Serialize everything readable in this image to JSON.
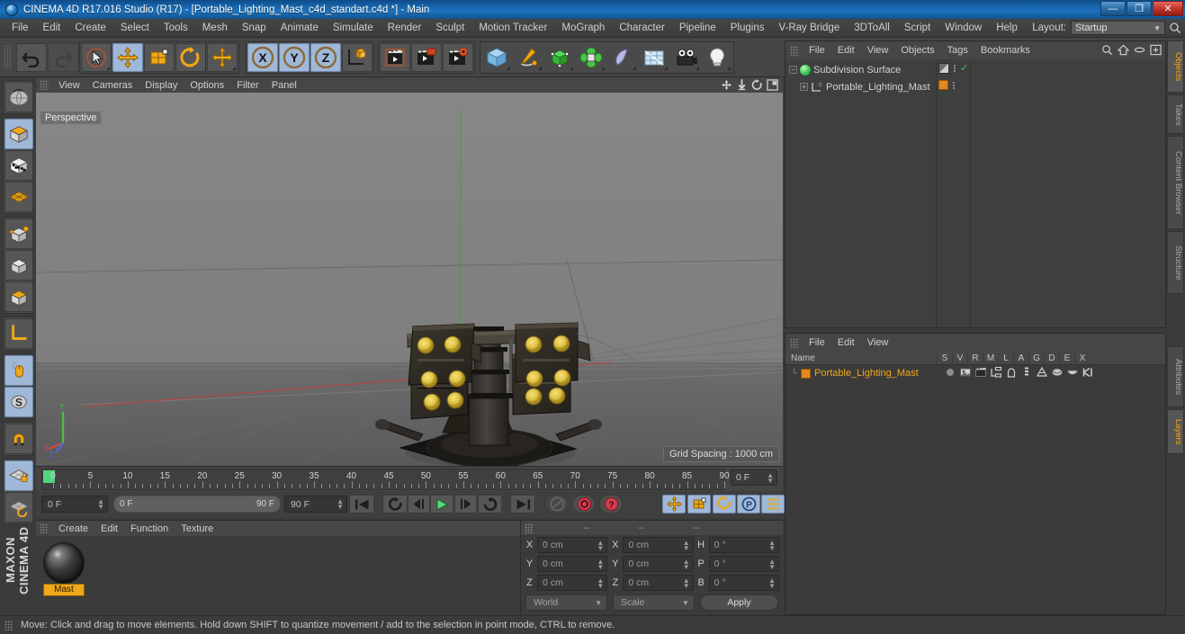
{
  "window": {
    "title": "CINEMA 4D R17.016 Studio (R17) - [Portable_Lighting_Mast_c4d_standart.c4d *] - Main",
    "minimize": "—",
    "restore": "❐",
    "close": "✕"
  },
  "menubar": {
    "items": [
      "File",
      "Edit",
      "Create",
      "Select",
      "Tools",
      "Mesh",
      "Snap",
      "Animate",
      "Simulate",
      "Render",
      "Sculpt",
      "Motion Tracker",
      "MoGraph",
      "Character",
      "Pipeline",
      "Plugins",
      "V-Ray Bridge",
      "3DToAll",
      "Script",
      "Window",
      "Help"
    ],
    "layout_label": "Layout:",
    "layout_value": "Startup"
  },
  "toolbar": {
    "undo": "undo-arrow",
    "redo": "redo-arrow",
    "select": "live-selection",
    "move": "move-tool",
    "scale": "scale-tool",
    "rotate": "rotate-tool",
    "axis_move": "move-axis",
    "x": "X",
    "y": "Y",
    "z": "Z",
    "world": "world-object-axis",
    "render_view": "render-view",
    "render_region": "render-region",
    "render_settings": "render-settings",
    "cube": "add-cube",
    "spline": "add-spline",
    "generator": "add-generator",
    "deformer": "add-deformer",
    "environment": "add-environment",
    "scene": "add-scene",
    "camera": "add-camera",
    "light": "add-light"
  },
  "left_tools": [
    {
      "name": "undo-view",
      "selected": false
    },
    {
      "name": "object-mode",
      "selected": true
    },
    {
      "name": "texture-mode",
      "selected": false
    },
    {
      "name": "point-mode-grid",
      "selected": false
    },
    {
      "name": "points-mode",
      "selected": false
    },
    {
      "name": "edges-mode",
      "selected": false
    },
    {
      "name": "polygons-mode",
      "selected": false
    },
    {
      "name": "axis-modify",
      "selected": false
    },
    {
      "name": "enable-modeling",
      "selected": true
    },
    {
      "name": "soft-selection",
      "selected": true
    },
    {
      "name": "magnet-tool",
      "selected": false
    },
    {
      "name": "lock-workplane",
      "selected": true
    },
    {
      "name": "workplane-mode",
      "selected": false
    }
  ],
  "maxon_text": "MAXON\nCINEMA 4D",
  "viewport": {
    "menu": [
      "View",
      "Cameras",
      "Display",
      "Options",
      "Filter",
      "Panel"
    ],
    "label": "Perspective",
    "grid_spacing": "Grid Spacing : 1000 cm",
    "icons": [
      "pan-icon",
      "dolly-icon",
      "rotate-icon",
      "maximize-icon"
    ]
  },
  "timeline": {
    "ticks": [
      "0",
      "5",
      "10",
      "15",
      "20",
      "25",
      "30",
      "35",
      "40",
      "45",
      "50",
      "55",
      "60",
      "65",
      "70",
      "75",
      "80",
      "85",
      "90"
    ],
    "current_field": "0 F"
  },
  "animbar": {
    "frame_current": "0 F",
    "range_start": "0 F",
    "range_end": "90 F",
    "frame_end": "90 F",
    "buttons": [
      {
        "name": "go-to-start",
        "glyph": "⏮",
        "selected": false
      },
      {
        "name": "play-reverse-loop",
        "glyph": "↺",
        "selected": false
      },
      {
        "name": "step-back",
        "glyph": "◀|",
        "selected": false
      },
      {
        "name": "play-forward",
        "glyph": "▶",
        "selected": false
      },
      {
        "name": "step-forward",
        "glyph": "|▶",
        "selected": false
      },
      {
        "name": "loop-playback",
        "glyph": "⟳",
        "selected": false
      },
      {
        "name": "go-to-end",
        "glyph": "⏭",
        "selected": false
      },
      {
        "name": "record-active-objects",
        "glyph": "◉",
        "selected": false
      },
      {
        "name": "autokeying",
        "glyph": "◯",
        "selected": false
      },
      {
        "name": "keyframe-selection",
        "glyph": "?",
        "selected": false
      },
      {
        "name": "position-key",
        "glyph": "✛",
        "selected": true
      },
      {
        "name": "scale-key",
        "glyph": "▣",
        "selected": true
      },
      {
        "name": "rotation-key",
        "glyph": "◌",
        "selected": true
      },
      {
        "name": "parameter-key",
        "glyph": "P",
        "selected": true
      },
      {
        "name": "pla-key",
        "glyph": "⣿",
        "selected": true
      },
      {
        "name": "timeline-toggle",
        "glyph": "▤",
        "selected": false
      }
    ]
  },
  "material_manager": {
    "menu": [
      "Create",
      "Edit",
      "Function",
      "Texture"
    ],
    "materials": [
      {
        "name": "Mast"
      }
    ]
  },
  "coordinates": {
    "header": [
      "--",
      "--",
      "--"
    ],
    "rows": [
      {
        "label1": "X",
        "value1": "0 cm",
        "label2": "X",
        "value2": "0 cm",
        "label3": "H",
        "value3": "0 °"
      },
      {
        "label1": "Y",
        "value1": "0 cm",
        "label2": "Y",
        "value2": "0 cm",
        "label3": "P",
        "value3": "0 °"
      },
      {
        "label1": "Z",
        "value1": "0 cm",
        "label2": "Z",
        "value2": "0 cm",
        "label3": "B",
        "value3": "0 °"
      }
    ],
    "system": "World",
    "mode": "Scale",
    "apply": "Apply"
  },
  "object_manager": {
    "menu": [
      "File",
      "Edit",
      "View",
      "Objects",
      "Tags",
      "Bookmarks"
    ],
    "icons": [
      "search-icon",
      "home-icon",
      "minus-icon",
      "add-icon"
    ],
    "rows": [
      {
        "name": "Subdivision Surface",
        "indent": 0,
        "icon": "subdivision-surface-icon",
        "check": "✓"
      },
      {
        "name": "Portable_Lighting_Mast",
        "indent": 1,
        "icon": "object-icon",
        "check": ""
      }
    ]
  },
  "layer_manager": {
    "menu": [
      "File",
      "Edit",
      "View"
    ],
    "columns": [
      "Name",
      "S",
      "V",
      "R",
      "M",
      "L",
      "A",
      "G",
      "D",
      "E",
      "X"
    ],
    "rows": [
      {
        "name": "Portable_Lighting_Mast"
      }
    ]
  },
  "edge_tabs": [
    {
      "label": "Objects",
      "active": true
    },
    {
      "label": "Takes",
      "active": false
    },
    {
      "label": "Content Browser",
      "active": false
    },
    {
      "label": "Structure",
      "active": false
    },
    {
      "label": "Attributes",
      "active": false
    },
    {
      "label": "Layers",
      "active": true
    }
  ],
  "status": {
    "message": "Move: Click and drag to move elements. Hold down SHIFT to quantize movement / add to the selection in point mode, CTRL to remove."
  },
  "colors": {
    "accent_orange": "#f0a818",
    "selection_blue": "#9fb8d8",
    "panel_bg": "#3b3b3b",
    "header_bg": "#464646",
    "titlebar_blue": "#1664ab",
    "green_marker": "#53d47f"
  }
}
